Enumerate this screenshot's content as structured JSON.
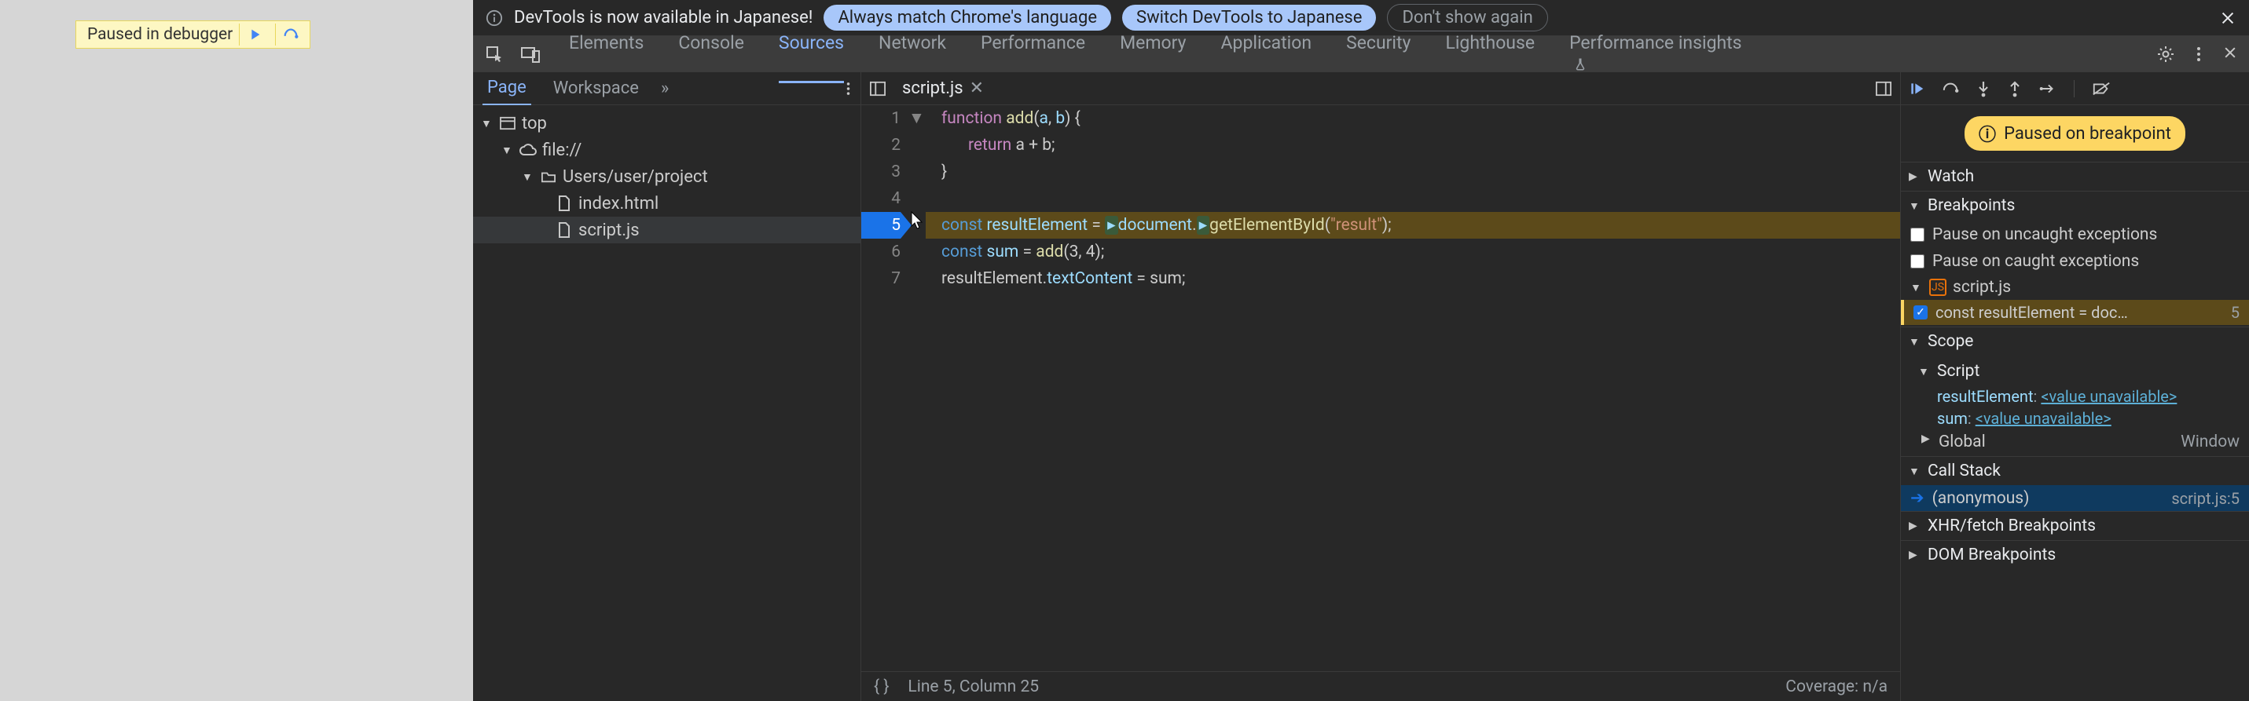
{
  "overlay": {
    "text": "Paused in debugger"
  },
  "infobar": {
    "message": "DevTools is now available in Japanese!",
    "btn_always": "Always match Chrome's language",
    "btn_switch": "Switch DevTools to Japanese",
    "btn_dismiss": "Don't show again"
  },
  "tabs": {
    "elements": "Elements",
    "console": "Console",
    "sources": "Sources",
    "network": "Network",
    "performance": "Performance",
    "memory": "Memory",
    "application": "Application",
    "security": "Security",
    "lighthouse": "Lighthouse",
    "perf_insights": "Performance insights"
  },
  "navigator": {
    "page": "Page",
    "workspace": "Workspace"
  },
  "tree": {
    "top": "top",
    "scheme": "file://",
    "folder": "Users/user/project",
    "file_html": "index.html",
    "file_js": "script.js"
  },
  "editor": {
    "tab_name": "script.js",
    "lines": {
      "1": {
        "n": "1"
      },
      "2": {
        "n": "2"
      },
      "3": {
        "n": "3"
      },
      "4": {
        "n": "4"
      },
      "5": {
        "n": "5"
      },
      "6": {
        "n": "6"
      },
      "7": {
        "n": "7"
      }
    },
    "code": {
      "l1_kw": "function ",
      "l1_fn": "add",
      "l1_paren": "(",
      "l1_a": "a",
      "l1_c": ", ",
      "l1_b": "b",
      "l1_rest": ") {",
      "l2_kw": "return ",
      "l2_rest": "a + b;",
      "l3": "}",
      "l4": "",
      "l5_kw": "const ",
      "l5_var": "resultElement",
      "l5_eq": " = ",
      "l5_doc": "document",
      "l5_dot": ".",
      "l5_fn": "getElementById",
      "l5_op": "(",
      "l5_str": "\"result\"",
      "l5_cl": ");",
      "l6_kw": "const ",
      "l6_var": "sum",
      "l6_eq": " = ",
      "l6_fn": "add",
      "l6_rest": "(3, 4);",
      "l7_a": "resultElement.",
      "l7_prop": "textContent",
      "l7_rest": " = sum;"
    }
  },
  "status": {
    "position": "Line 5, Column 25",
    "coverage": "Coverage: n/a"
  },
  "debugger": {
    "paused": "Paused on breakpoint",
    "watch": "Watch",
    "breakpoints": "Breakpoints",
    "pause_uncaught": "Pause on uncaught exceptions",
    "pause_caught": "Pause on caught exceptions",
    "bp_file": "script.js",
    "bp_line_text": "const resultElement = doc…",
    "bp_line_num": "5",
    "scope": "Scope",
    "script": "Script",
    "var1_name": "resultElement",
    "var1_val": "<value unavailable>",
    "var2_name": "sum",
    "var2_val": "<value unavailable>",
    "global": "Global",
    "global_val": "Window",
    "callstack": "Call Stack",
    "frame_name": "(anonymous)",
    "frame_loc": "script.js:5",
    "xhr": "XHR/fetch Breakpoints",
    "dom": "DOM Breakpoints"
  }
}
